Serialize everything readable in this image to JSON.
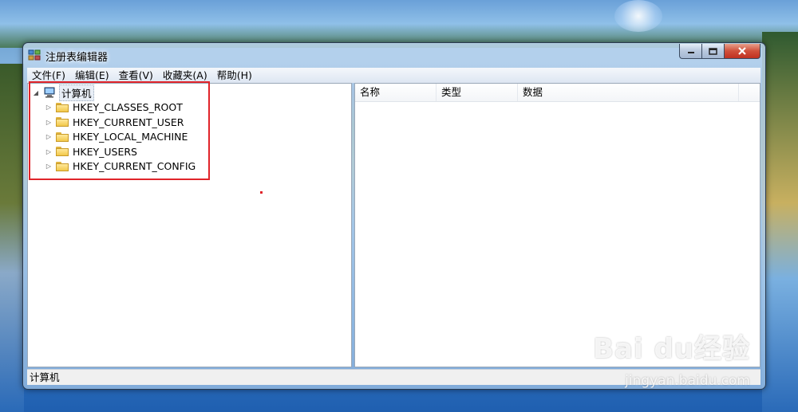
{
  "window": {
    "title": "注册表编辑器"
  },
  "menu": [
    "文件(F)",
    "编辑(E)",
    "查看(V)",
    "收藏夹(A)",
    "帮助(H)"
  ],
  "tree": {
    "root": "计算机",
    "children": [
      "HKEY_CLASSES_ROOT",
      "HKEY_CURRENT_USER",
      "HKEY_LOCAL_MACHINE",
      "HKEY_USERS",
      "HKEY_CURRENT_CONFIG"
    ]
  },
  "columns": [
    "名称",
    "类型",
    "数据"
  ],
  "status": "计算机",
  "watermark": {
    "brand": "Bai du经验",
    "url": "jingyan.baidu.com"
  },
  "colors": {
    "highlight": "#e0242a",
    "close": "#c03020"
  }
}
